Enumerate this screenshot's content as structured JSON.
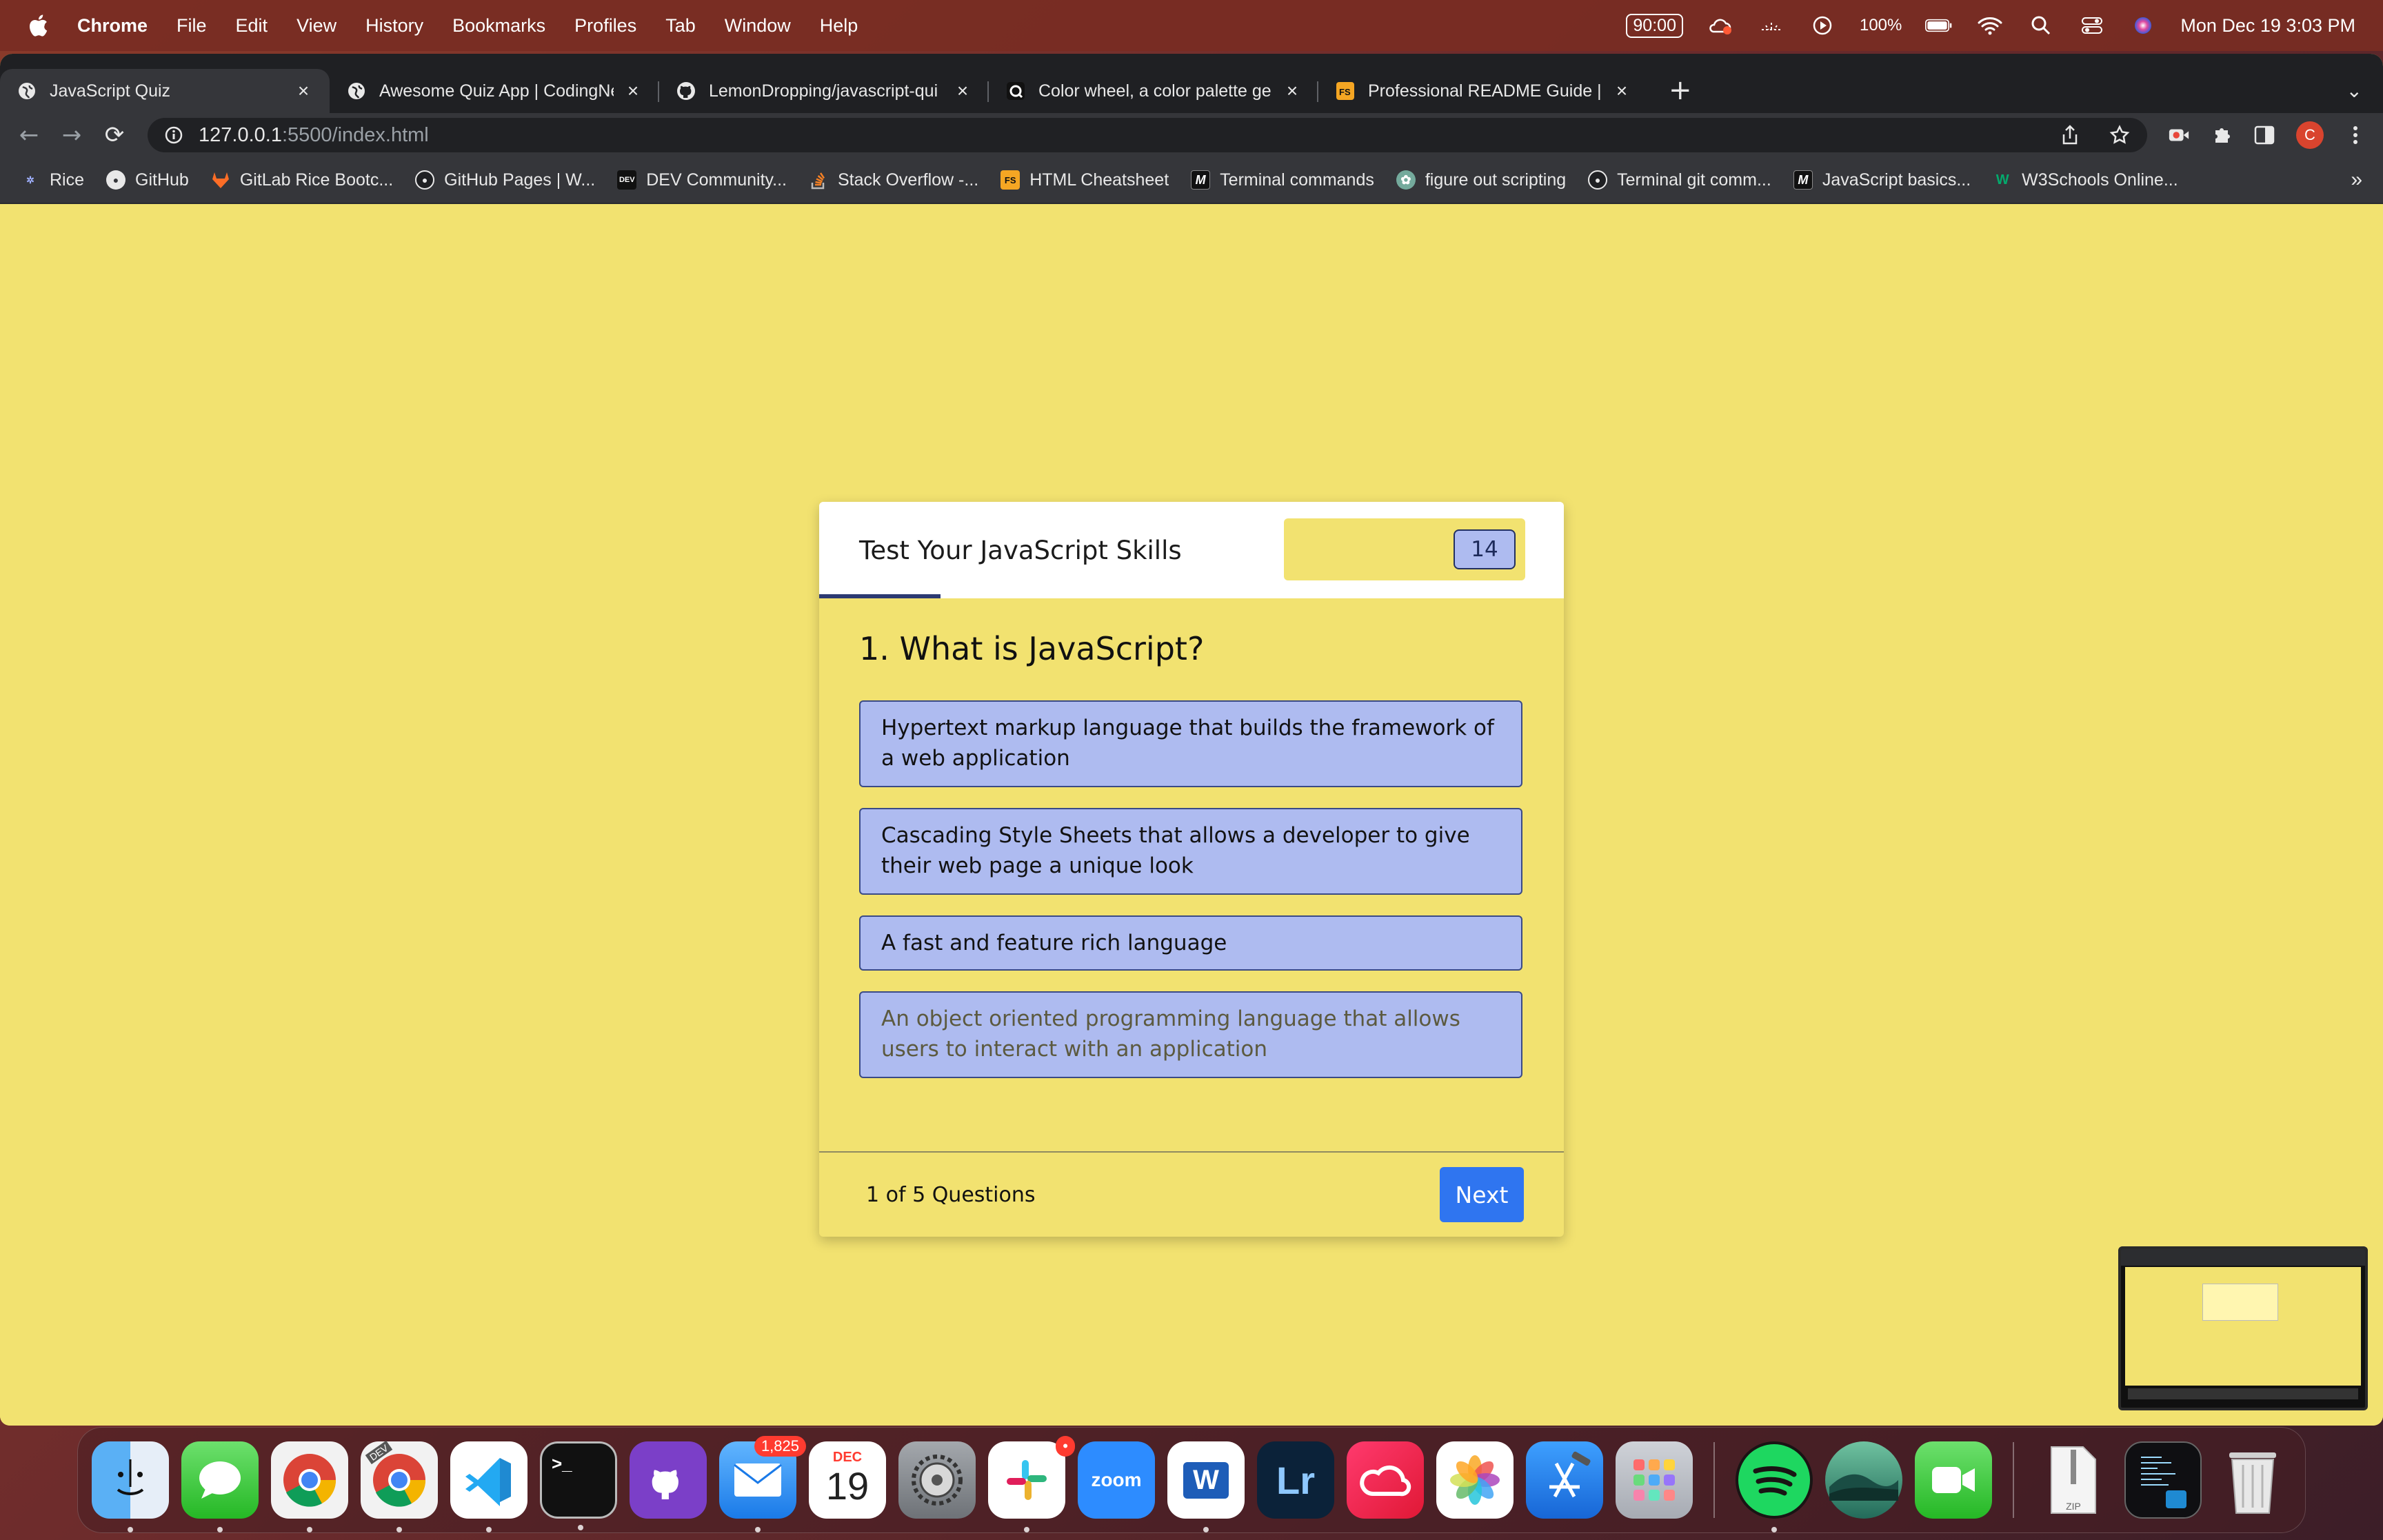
{
  "menubar": {
    "app_name": "Chrome",
    "menus": [
      "File",
      "Edit",
      "View",
      "History",
      "Bookmarks",
      "Profiles",
      "Tab",
      "Window",
      "Help"
    ],
    "timer_badge": "90:00",
    "battery": "100%",
    "datetime": "Mon Dec 19  3:03 PM"
  },
  "tabs": [
    {
      "title": "JavaScript Quiz",
      "active": true
    },
    {
      "title": "Awesome Quiz App | CodingNe",
      "active": false
    },
    {
      "title": "LemonDropping/javascript-qui",
      "active": false
    },
    {
      "title": "Color wheel, a color palette ge",
      "active": false
    },
    {
      "title": "Professional README Guide | T",
      "active": false
    }
  ],
  "omnibox": {
    "host": "127.0.0.1",
    "path": ":5500/index.html"
  },
  "bookmarks": [
    {
      "label": "Rice",
      "icon": "rice-icon"
    },
    {
      "label": "GitHub",
      "icon": "github-icon"
    },
    {
      "label": "GitLab Rice Bootc...",
      "icon": "gitlab-icon"
    },
    {
      "label": "GitHub Pages | W...",
      "icon": "github-icon"
    },
    {
      "label": "DEV Community...",
      "icon": "dev-icon"
    },
    {
      "label": "Stack Overflow -...",
      "icon": "stackoverflow-icon"
    },
    {
      "label": "HTML Cheatsheet",
      "icon": "fs-icon"
    },
    {
      "label": "Terminal commands",
      "icon": "medium-icon"
    },
    {
      "label": "figure out scripting",
      "icon": "openai-icon"
    },
    {
      "label": "Terminal git comm...",
      "icon": "github-icon"
    },
    {
      "label": "JavaScript basics...",
      "icon": "medium-icon"
    },
    {
      "label": "W3Schools Online...",
      "icon": "w3schools-icon"
    }
  ],
  "quiz": {
    "title": "Test Your JavaScript Skills",
    "timer_seconds": "14",
    "question": "1. What is JavaScript?",
    "options": [
      "Hypertext markup language that builds the framework of a web application",
      "Cascading Style Sheets that allows a developer to give their web page a unique look",
      "A fast and feature rich language",
      "An object oriented programming language that allows users to interact with an application"
    ],
    "progress_text": "1 of 5 Questions",
    "next_label": "Next"
  },
  "dock": {
    "mail_badge": "1,825",
    "calendar_month": "DEC",
    "calendar_day": "19",
    "zoom_label": "zoom",
    "lightroom_label": "Lr",
    "word_label": "W",
    "zip_label": "ZIP",
    "chrome_dev_label": "DEV",
    "slack_badge": "•"
  },
  "colors": {
    "page_bg": "#f2e270",
    "option_bg": "#aebbf0",
    "next_button": "#2f75f0",
    "header_underline": "#2c3a72"
  }
}
